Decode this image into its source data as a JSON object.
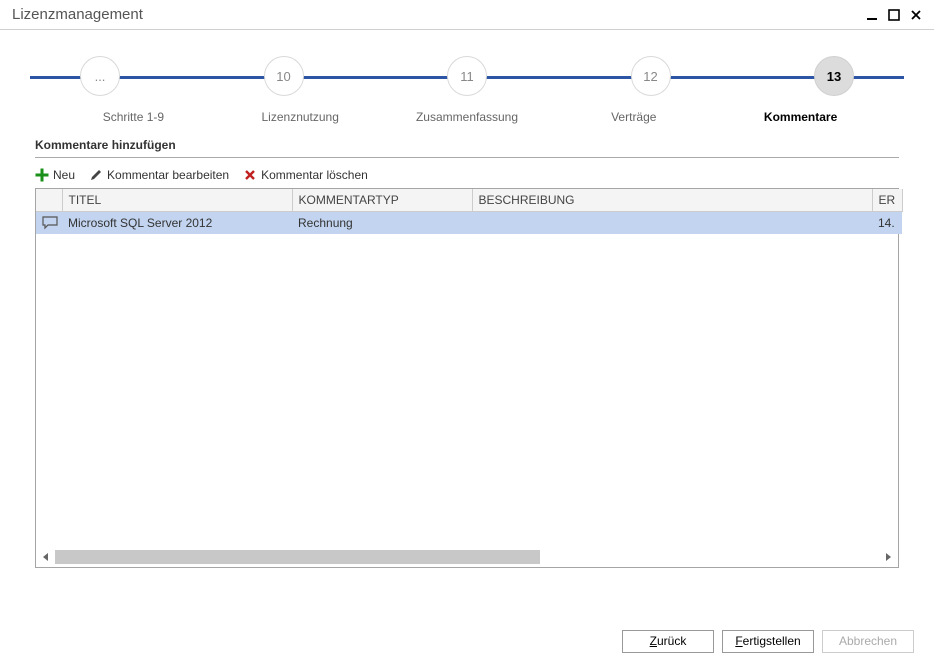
{
  "window": {
    "title": "Lizenzmanagement"
  },
  "stepper": {
    "steps": [
      {
        "num": "...",
        "label": "Schritte 1-9",
        "active": false
      },
      {
        "num": "10",
        "label": "Lizenznutzung",
        "active": false
      },
      {
        "num": "11",
        "label": "Zusammenfassung",
        "active": false
      },
      {
        "num": "12",
        "label": "Verträge",
        "active": false
      },
      {
        "num": "13",
        "label": "Kommentare",
        "active": true
      }
    ]
  },
  "section_title": "Kommentare hinzufügen",
  "toolbar": {
    "new": "Neu",
    "edit": "Kommentar bearbeiten",
    "delete": "Kommentar löschen"
  },
  "table": {
    "columns": {
      "icon": "",
      "title": "TITEL",
      "type": "KOMMENTARTYP",
      "desc": "BESCHREIBUNG",
      "er": "ER"
    },
    "rows": [
      {
        "title": "Microsoft SQL Server 2012",
        "type": "Rechnung",
        "desc": "",
        "er": "14."
      }
    ]
  },
  "footer": {
    "back": {
      "letter": "Z",
      "rest": "urück"
    },
    "finish": {
      "letter": "F",
      "rest": "ertigstellen"
    },
    "cancel": {
      "label": "Abbrechen"
    }
  }
}
